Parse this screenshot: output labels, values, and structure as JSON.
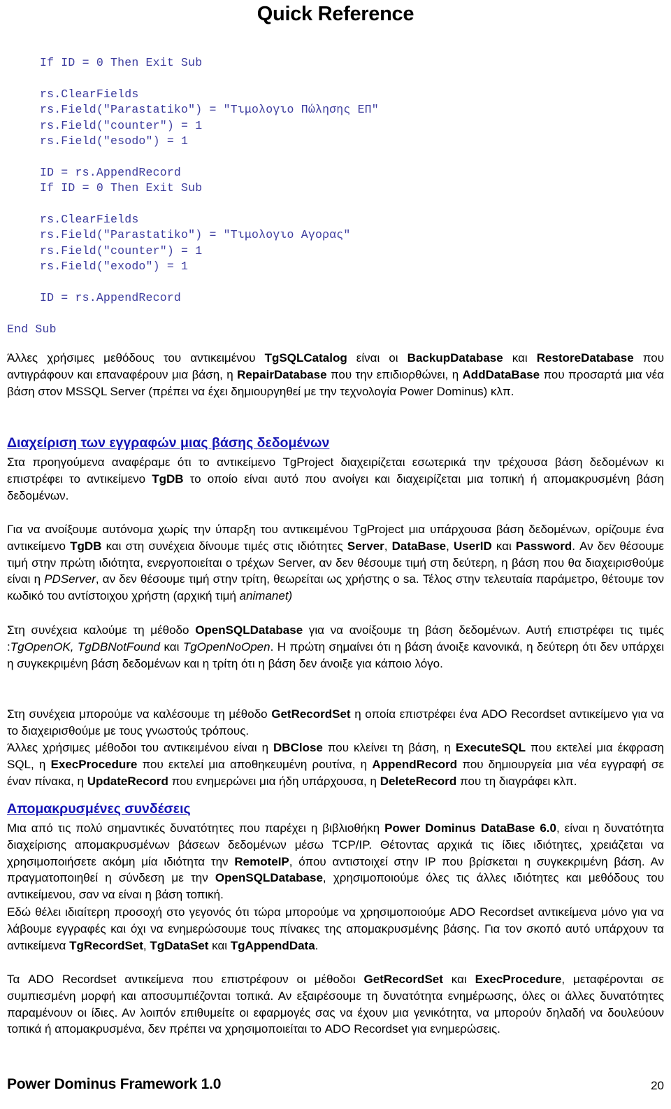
{
  "document": {
    "title": "Quick Reference",
    "footer": {
      "title": "Power Dominus Framework 1.0",
      "page_number": "20"
    }
  },
  "colors": {
    "code_text": "#3b3b9e",
    "heading": "#1414b4",
    "body_text": "#000000",
    "background": "#ffffff"
  },
  "code_block": {
    "lines": [
      {
        "indent": 1,
        "text": "If ID = 0 Then Exit Sub"
      },
      {
        "indent": 1,
        "text": ""
      },
      {
        "indent": 1,
        "text": "rs.ClearFields"
      },
      {
        "indent": 1,
        "text": "rs.Field(\"Parastatiko\") = \"Τιμολογιο Πώλησης ΕΠ\""
      },
      {
        "indent": 1,
        "text": "rs.Field(\"counter\") = 1"
      },
      {
        "indent": 1,
        "text": "rs.Field(\"esodo\") = 1"
      },
      {
        "indent": 1,
        "text": ""
      },
      {
        "indent": 1,
        "text": "ID = rs.AppendRecord"
      },
      {
        "indent": 1,
        "text": "If ID = 0 Then Exit Sub"
      },
      {
        "indent": 1,
        "text": ""
      },
      {
        "indent": 1,
        "text": "rs.ClearFields"
      },
      {
        "indent": 1,
        "text": "rs.Field(\"Parastatiko\") = \"Τιμολογιο Αγορας\""
      },
      {
        "indent": 1,
        "text": "rs.Field(\"counter\") = 1"
      },
      {
        "indent": 1,
        "text": "rs.Field(\"exodo\") = 1"
      },
      {
        "indent": 1,
        "text": ""
      },
      {
        "indent": 1,
        "text": "ID = rs.AppendRecord"
      },
      {
        "indent": 1,
        "text": ""
      },
      {
        "indent": 0,
        "text": "End Sub"
      }
    ]
  },
  "body": {
    "para_1_html": "Άλλες χρήσιμες μεθόδους του αντικειμένου <b>TgSQLCatalog</b> είναι οι <b>BackupDatabase</b> και <b>RestoreDatabase</b> που αντιγράφουν και επαναφέρουν μια βάση,  η <b>RepairDatabase</b> που την επιδιορθώνει,  η <b>AddDataBase</b> που προσαρτά μια νέα βάση στον MSSQL Server (πρέπει να έχει δημιουργηθεί με την τεχνολογία Power Dominus) κλπ.",
    "heading_1": "Διαχείριση των εγγραφών μιας βάσης δεδομένων",
    "para_2_html": "Στα προηγούμενα αναφέραμε ότι το αντικείμενο TgProject διαχειρίζεται εσωτερικά την τρέχουσα βάση δεδομένων κι επιστρέφει το αντικείμενο <b>TgDB</b> το οποίο είναι αυτό που ανοίγει και διαχειρίζεται μια τοπική ή απομακρυσμένη βάση δεδομένων.",
    "para_3_html": "Για να ανοίξουμε αυτόνομα χωρίς την ύπαρξη του αντικειμένου TgProject μια υπάρχουσα βάση δεδομένων, ορίζουμε ένα αντικείμενο <b>TgDB</b> και στη συνέχεια δίνουμε τιμές στις ιδιότητες <b>Server</b>, <b>DataBase</b>, <b>UserID</b> και <b>Password</b>. Αν δεν θέσουμε τιμή στην πρώτη ιδιότητα, ενεργοποιείται ο τρέχων Server, αν δεν θέσουμε τιμή στη δεύτερη, η βάση που θα διαχειρισθούμε είναι η <i>PDServer</i>, αν δεν θέσουμε τιμή στην τρίτη, θεωρείται ως χρήστης ο sa. Τέλος στην τελευταία παράμετρο, θέτουμε τον κωδικό του αντίστοιχου χρήστη (αρχική τιμή <i>animanet)</i>",
    "para_4_html": "Στη συνέχεια καλούμε τη μέθοδο <b>OpenSQLDatabase</b> για να ανοίξουμε τη βάση δεδομένων. Αυτή επιστρέφει τις τιμές :<i>TgOpenOK,  TgDBNotFound</i> και <i>TgOpenNoOpen</i>. Η πρώτη σημαίνει ότι η βάση άνοιξε κανονικά, η δεύτερη ότι δεν υπάρχει η συγκεκριμένη βάση δεδομένων και η τρίτη ότι η βάση δεν άνοιξε για κάποιο λόγο.",
    "para_5_html": "Στη συνέχεια μπορούμε να καλέσουμε τη  μέθοδο <b>GetRecordSet</b> η οποία επιστρέφει ένα ADO Recordset αντικείμενο για να το διαχειρισθούμε με τους γνωστούς τρόπους.",
    "para_6_html": "Άλλες χρήσιμες μέθοδοι του αντικειμένου είναι η <b>DBClose</b>  που κλείνει τη βάση, η <b>ExecuteSQL</b> που εκτελεί μια έκφραση SQL,  η <b>ExecProcedure</b> που εκτελεί μια αποθηκευμένη ρουτίνα,  η <b>AppendRecord</b> που δημιουργεία μια νέα εγγραφή σε έναν πίνακα, η <b>UpdateRecord</b> που ενημερώνει μια ήδη υπάρχουσα, η <b>DeleteRecord</b> που τη διαγράφει κλπ.",
    "heading_2": "Απομακρυσμένες συνδέσεις",
    "para_7_html": "Μια από τις πολύ σημαντικές δυνατότητες που παρέχει η βιβλιοθήκη <b>Power Dominus DataBase 6.0</b>, είναι η δυνατότητα διαχείρισης απομακρυσμένων βάσεων δεδομένων μέσω TCP/IP. Θέτοντας αρχικά τις ίδιες ιδιότητες, χρειάζεται να χρησιμοποιήσετε ακόμη μία ιδιότητα την <b>RemoteIP</b>, όπου αντιστοιχεί στην  IP που βρίσκεται η συγκεκριμένη βάση. Αν πραγματοποιηθεί η σύνδεση με την <b>OpenSQLDatabase</b>, χρησιμοποιούμε όλες τις άλλες ιδιότητες και μεθόδους του αντικείμενου, σαν να είναι η βάση τοπική.",
    "para_8_html": "Εδώ θέλει ιδιαίτερη προσοχή στο γεγονός ότι τώρα μπορούμε να χρησιμοποιούμε ADO Recordset αντικείμενα μόνο για να λάβουμε εγγραφές και όχι να ενημερώσουμε τους πίνακες της απομακρυσμένης βάσης. Για τον σκοπό αυτό υπάρχουν τα αντικείμενα <b>TgRecordSet</b>, <b>TgDataSet</b> και <b>TgAppendData</b>.",
    "para_9_html": "Τα ADO Recordset αντικείμενα που επιστρέφουν οι μέθοδοι <b>GetRecordSet</b> και <b>ExecProcedure</b>, μεταφέρονται σε συμπιεσμένη μορφή και αποσυμπιέζονται τοπικά. Αν εξαιρέσουμε τη δυνατότητα ενημέρωσης, όλες οι άλλες δυνατότητες παραμένουν οι ίδιες. Αν λοιπόν επιθυμείτε οι εφαρμογές σας να έχουν μια γενικότητα, να μπορούν δηλαδή να δουλεύουν τοπικά ή απομακρυσμένα, δεν πρέπει να χρησιμοποιείται το ADO Recordset για ενημερώσεις."
  }
}
